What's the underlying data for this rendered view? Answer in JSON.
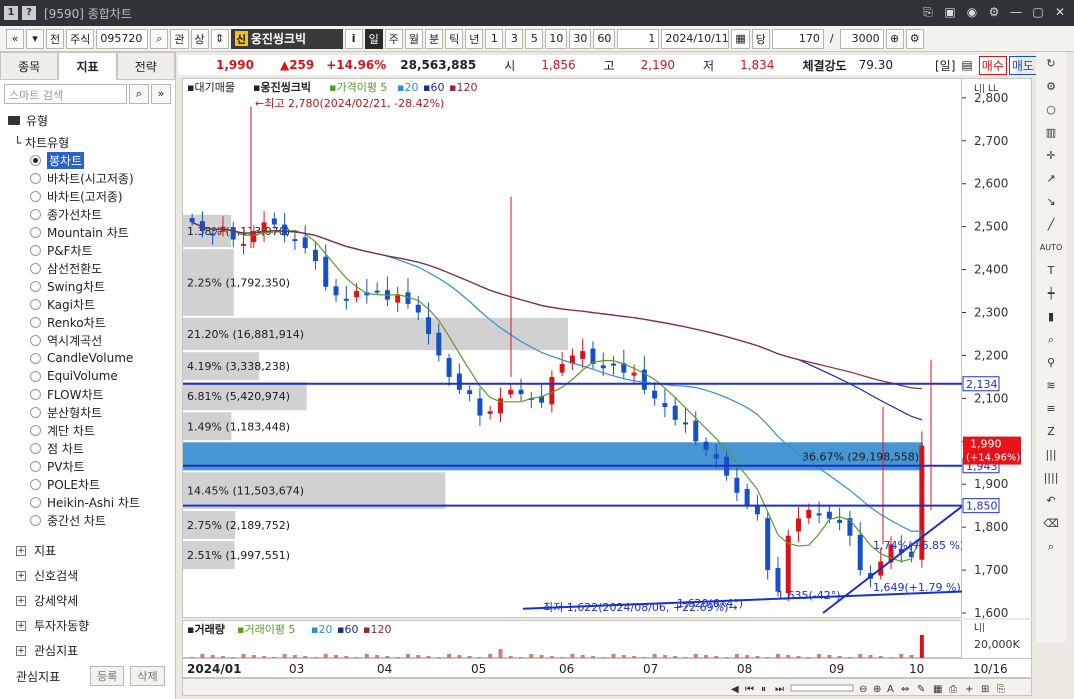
{
  "window": {
    "title": "[9590] 종합차트",
    "icon_1": "1",
    "icon_2": "?"
  },
  "toolbar": {
    "nav_prev": "«",
    "nav_down": "»",
    "jeon": "전",
    "jusik": "주식",
    "code": "095720",
    "gwan": "관",
    "sang": "상",
    "shin_badge": "신",
    "stock_name": "웅진씽크빅",
    "info_btn": "i",
    "periods": [
      "일",
      "주",
      "월",
      "분",
      "틱",
      "년"
    ],
    "active_period": "일",
    "numbers": [
      "1",
      "3",
      "5",
      "10",
      "30",
      "60"
    ],
    "interval": "1",
    "date": "2024/10/11",
    "dang": "당",
    "count": "170",
    "slash": "/",
    "total": "3000"
  },
  "left_panel": {
    "tabs": [
      "종목",
      "지표",
      "전략"
    ],
    "selected_tab": "지표",
    "search_placeholder": "스마트 검색",
    "category": "유형",
    "subcategory": "차트유형",
    "chart_types": [
      "봉차트",
      "바차트(시고저종)",
      "바차트(고저종)",
      "종가선차트",
      "Mountain 차트",
      "P&F차트",
      "삼선전환도",
      "Swing차트",
      "Kagi차트",
      "Renko차트",
      "역시계곡선",
      "CandleVolume",
      "EquiVolume",
      "FLOW차트",
      "분산형차트",
      "계단 차트",
      "점 차트",
      "PV차트",
      "POLE차트",
      "Heikin-Ashi 차트",
      "중간선 차트"
    ],
    "selected_type": "봉차트",
    "groups": [
      "지표",
      "신호검색",
      "강세약세",
      "투자자동향",
      "관심지표"
    ],
    "bottom_label": "관심지표",
    "register_btn": "등록",
    "delete_btn": "삭제"
  },
  "quote": {
    "price": "1,990",
    "change": "▲259",
    "change_pct": "+14.96%",
    "volume": "28,563,885",
    "open_label": "시",
    "open": "1,856",
    "high_label": "고",
    "high": "2,190",
    "low_label": "저",
    "low": "1,834",
    "strength_label": "체결강도",
    "strength": "79.30",
    "day_label": "[일]",
    "buy": "매수",
    "sell": "매도"
  },
  "legend": {
    "label1": "대기매물",
    "label2": "웅진씽크빅",
    "ma_label": "가격이평",
    "ma_periods": [
      "5",
      "20",
      "60",
      "120"
    ],
    "ma_colors": [
      "#5a9c2a",
      "#2f8fd3",
      "#1c2d8c",
      "#8c2a3a"
    ]
  },
  "annotations": {
    "high_note": "←최고 2,780(2024/02/21, -28.42%)",
    "low_note": "최저 1,622(2024/08/06, +22.69%)→",
    "trend1": "1,620(6x4°)",
    "trend2": "1,635(-42°)",
    "trend3": "1,649(+1.79 %)",
    "trend4": "1,74%(+6.85 %)"
  },
  "volume_profile": [
    {
      "label": "1.38% (1,113,070)",
      "from": 2450,
      "to": 2530,
      "pct": 1.38
    },
    {
      "label": "2.25% (1,792,350)",
      "from": 2290,
      "to": 2450,
      "pct": 2.25
    },
    {
      "label": "21.20% (16,881,914)",
      "from": 2210,
      "to": 2290,
      "pct": 21.2
    },
    {
      "label": "4.19% (3,338,238)",
      "from": 2140,
      "to": 2210,
      "pct": 4.19
    },
    {
      "label": "6.81% (5,420,974)",
      "from": 2070,
      "to": 2140,
      "pct": 6.81
    },
    {
      "label": "1.49% (1,183,448)",
      "from": 2000,
      "to": 2070,
      "pct": 1.49
    },
    {
      "label": "36.67% (29,198,558)",
      "from": 1930,
      "to": 2000,
      "pct": 36.67
    },
    {
      "label": "14.45% (11,503,674)",
      "from": 1840,
      "to": 1930,
      "pct": 14.45
    },
    {
      "label": "2.75% (2,189,752)",
      "from": 1770,
      "to": 1840,
      "pct": 2.75
    },
    {
      "label": "2.51% (1,997,551)",
      "from": 1700,
      "to": 1770,
      "pct": 2.51
    }
  ],
  "levels": [
    {
      "value": 2134,
      "label": "2,134"
    },
    {
      "value": 1943,
      "label": "1,943"
    },
    {
      "value": 1850,
      "label": "1,850"
    }
  ],
  "current_label": {
    "price": "1,990",
    "pct": "(+14.96%)"
  },
  "yaxis": {
    "header": "L|| LL",
    "ticks": [
      "2,800",
      "2,700",
      "2,600",
      "2,500",
      "2,400",
      "2,300",
      "2,200",
      "2,100",
      "2,000",
      "1,900",
      "1,800",
      "1,700",
      "1,600"
    ]
  },
  "vol_legend": {
    "label": "거래량",
    "ma_label": "거래이평",
    "periods": [
      "5",
      "20",
      "60",
      "120"
    ]
  },
  "vol_axis": {
    "header": "L||",
    "tick": "20,000K"
  },
  "xaxis": {
    "year": "2024/01",
    "months": [
      "03",
      "04",
      "05",
      "06",
      "07",
      "08",
      "09",
      "10"
    ],
    "last": "10/16"
  },
  "chart_data": {
    "type": "candlestick",
    "ylim": [
      1600,
      2830
    ],
    "close_path": [
      2510,
      2490,
      2480,
      2500,
      2470,
      2460,
      2490,
      2510,
      2505,
      2480,
      2470,
      2450,
      2420,
      2360,
      2340,
      2330,
      2350,
      2340,
      2350,
      2330,
      2340,
      2320,
      2300,
      2250,
      2200,
      2150,
      2120,
      2110,
      2060,
      2070,
      2100,
      2120,
      2110,
      2100,
      2090,
      2150,
      2180,
      2200,
      2210,
      2180,
      2170,
      2180,
      2160,
      2160,
      2120,
      2100,
      2080,
      2050,
      2040,
      2000,
      1980,
      1960,
      1920,
      1880,
      1850,
      1830,
      1700,
      1650,
      1780,
      1820,
      1840,
      1830,
      1820,
      1810,
      1780,
      1700,
      1680,
      1720,
      1760,
      1740,
      1730,
      1990
    ],
    "ma_periods": [
      5,
      20,
      60,
      120
    ]
  }
}
